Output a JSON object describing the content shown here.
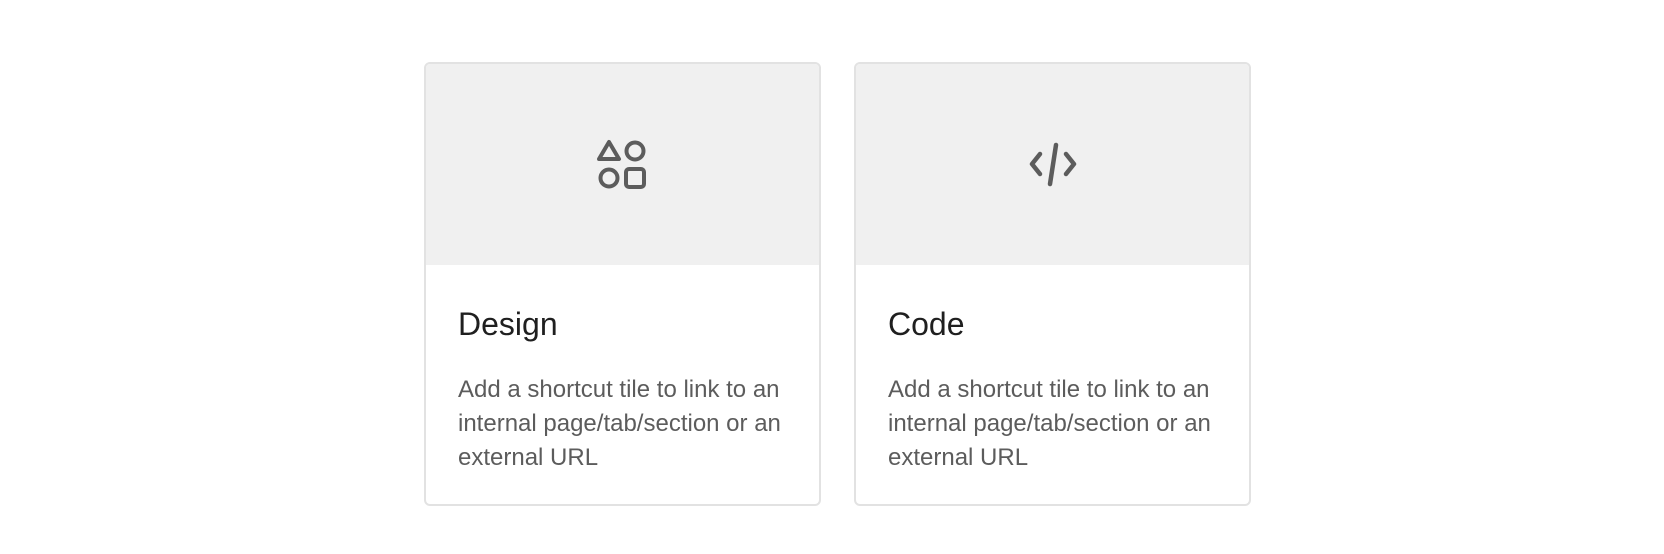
{
  "tiles": [
    {
      "icon": "shapes-icon",
      "title": "Design",
      "description": "Add a shortcut tile to link to an internal page/tab/section or an external URL"
    },
    {
      "icon": "code-icon",
      "title": "Code",
      "description": "Add a shortcut tile to link to an internal page/tab/section or an external URL"
    }
  ],
  "colors": {
    "banner_background": "#f0f0f0",
    "icon": "#5c5c5c",
    "title": "#1f1f1f",
    "description": "#5c5c5c",
    "border": "#e2e2e2"
  }
}
